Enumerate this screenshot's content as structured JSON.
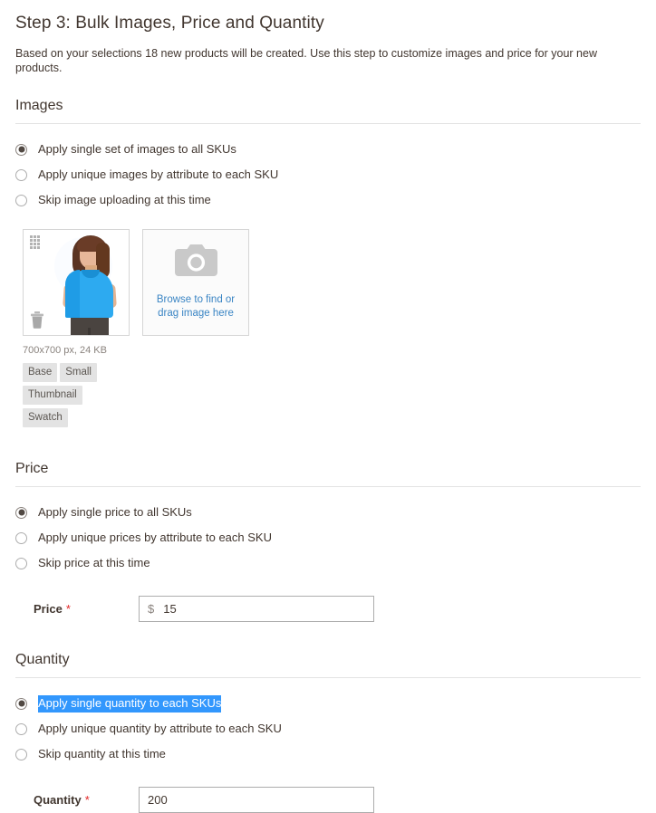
{
  "header": {
    "title": "Step 3: Bulk Images, Price and Quantity",
    "subtitle": "Based on your selections 18 new products will be created. Use this step to customize images and price for your new products."
  },
  "images_section": {
    "title": "Images",
    "options": [
      {
        "label": "Apply single set of images to all SKUs",
        "selected": true
      },
      {
        "label": "Apply unique images by attribute to each SKU",
        "selected": false
      },
      {
        "label": "Skip image uploading at this time",
        "selected": false
      }
    ],
    "thumbnail": {
      "drag_handle_icon": "drag-handle-icon",
      "delete_icon": "trash-icon",
      "file_meta": "700x700 px, 24 KB",
      "role_tags": [
        "Base",
        "Small",
        "Thumbnail",
        "Swatch"
      ]
    },
    "uploader": {
      "icon": "camera-icon",
      "line1": "Browse to find or",
      "line2": "drag image here",
      "link_color": "#3a85c4"
    }
  },
  "price_section": {
    "title": "Price",
    "options": [
      {
        "label": "Apply single price to all SKUs",
        "selected": true
      },
      {
        "label": "Apply unique prices by attribute to each SKU",
        "selected": false
      },
      {
        "label": "Skip price at this time",
        "selected": false
      }
    ],
    "field": {
      "label": "Price",
      "required_mark": "*",
      "currency": "$",
      "value": "15"
    }
  },
  "quantity_section": {
    "title": "Quantity",
    "options": [
      {
        "label": "Apply single quantity to each SKUs",
        "selected": true,
        "text_highlighted": true
      },
      {
        "label": "Apply unique quantity by attribute to each SKU",
        "selected": false
      },
      {
        "label": "Skip quantity at this time",
        "selected": false
      }
    ],
    "field": {
      "label": "Quantity",
      "required_mark": "*",
      "value": "200"
    }
  },
  "colors": {
    "text": "#41362f",
    "muted": "#8a837e",
    "rule": "#e3e3e3",
    "selection_highlight": "#3297fd",
    "required": "#e22626",
    "link": "#3a85c4"
  }
}
